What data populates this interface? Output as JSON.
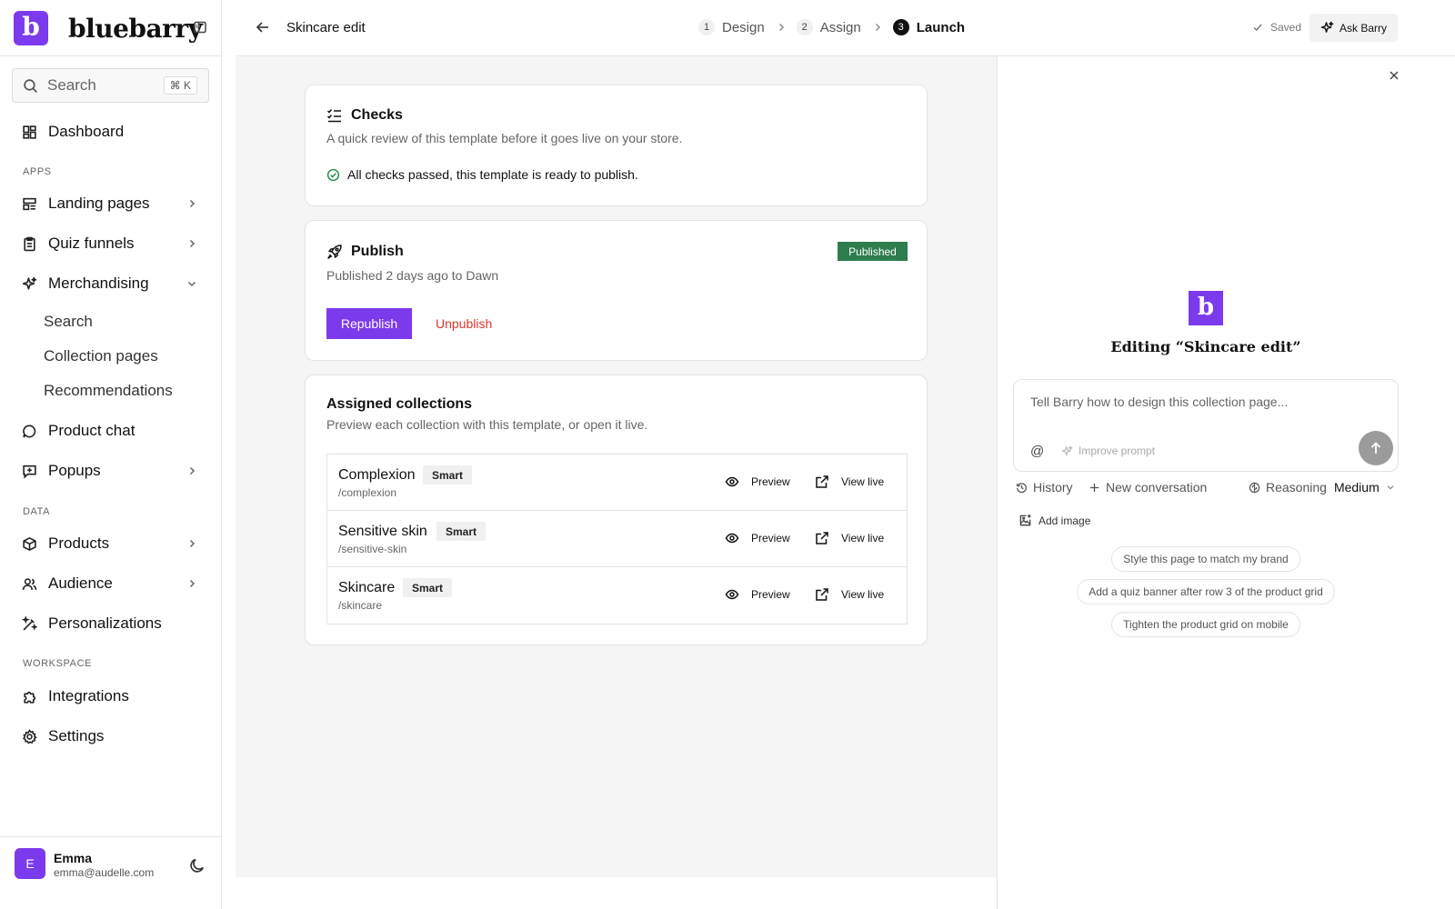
{
  "app": {
    "logo_letter": "b",
    "name": "bluebarry",
    "brand_color": "#7c3aed"
  },
  "sidebar": {
    "search": {
      "label": "Search",
      "shortcut": "⌘ K"
    },
    "dashboard": {
      "label": "Dashboard",
      "icon": "dashboard-icon"
    },
    "sections": {
      "apps": "APPS",
      "data": "DATA",
      "workspace": "WORKSPACE"
    },
    "items": [
      {
        "label": "Landing pages",
        "icon": "layout-icon"
      },
      {
        "label": "Quiz funnels",
        "icon": "clipboard-icon"
      },
      {
        "label": "Merchandising",
        "icon": "sparkles-icon",
        "expanded": true
      },
      {
        "label": "Product chat",
        "icon": "chat-icon"
      },
      {
        "label": "Popups",
        "icon": "popup-icon"
      },
      {
        "label": "Products",
        "icon": "box-icon"
      },
      {
        "label": "Audience",
        "icon": "users-icon"
      },
      {
        "label": "Personalizations",
        "icon": "wand-icon"
      },
      {
        "label": "Integrations",
        "icon": "puzzle-icon"
      },
      {
        "label": "Settings",
        "icon": "gear-icon"
      }
    ],
    "merch_sub": [
      "Search",
      "Collection pages",
      "Recommendations"
    ],
    "user": {
      "initial": "E",
      "name": "Emma",
      "email": "emma@audelle.com"
    }
  },
  "topbar": {
    "page_name": "Skincare edit",
    "steps": [
      {
        "num": "1",
        "label": "Design"
      },
      {
        "num": "2",
        "label": "Assign"
      },
      {
        "num": "3",
        "label": "Launch",
        "active": true
      }
    ],
    "saved": "Saved",
    "ask": "Ask Barry"
  },
  "checks": {
    "title": "Checks",
    "desc": "A quick review of this template before it goes live on your store.",
    "status": "All checks passed, this template is ready to publish.",
    "status_color": "#1f8a4c"
  },
  "publish": {
    "title": "Publish",
    "desc": "Published 2 days ago to Dawn",
    "badge": "Published",
    "badge_color": "#2e7d4f",
    "republish": "Republish",
    "unpublish": "Unpublish"
  },
  "assigned": {
    "title": "Assigned collections",
    "desc": "Preview each collection with this template, or open it live.",
    "preview_label": "Preview",
    "live_label": "View live",
    "rows": [
      {
        "name": "Complexion",
        "tag": "Smart",
        "handle": "/complexion"
      },
      {
        "name": "Sensitive skin",
        "tag": "Smart",
        "handle": "/sensitive-skin"
      },
      {
        "name": "Skincare",
        "tag": "Smart",
        "handle": "/skincare"
      }
    ]
  },
  "assistant": {
    "logo_letter": "b",
    "heading": "Editing “Skincare edit”",
    "placeholder": "Tell Barry how to design this collection page...",
    "at": "@",
    "improve": "Improve prompt",
    "history": "History",
    "new_conversation": "New conversation",
    "reasoning_label": "Reasoning",
    "reasoning_value": "Medium",
    "add_image": "Add image",
    "suggestions": [
      "Style this page to match my brand",
      "Add a quiz banner after row 3 of the product grid",
      "Tighten the product grid on mobile"
    ]
  }
}
